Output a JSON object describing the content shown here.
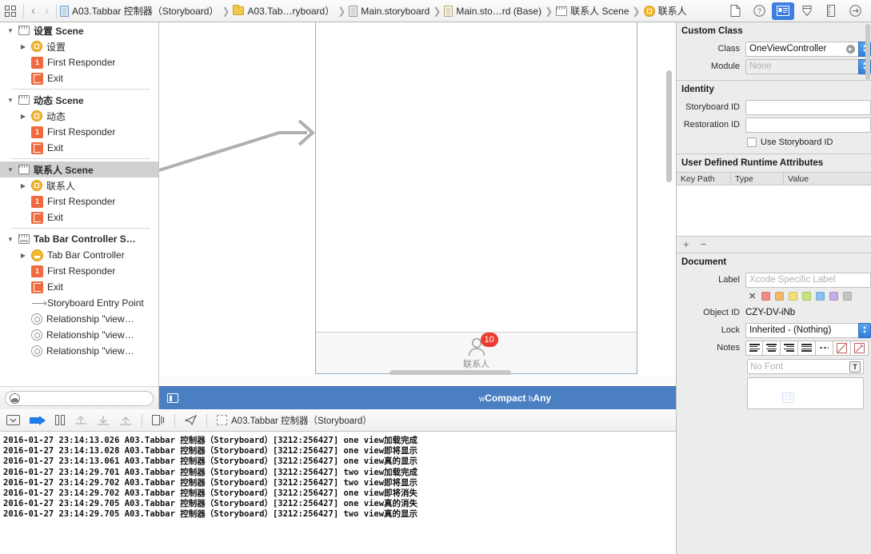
{
  "jumpbar": {
    "grid_icon": "grid-view-icon",
    "back_label": "‹",
    "forward_label": "›",
    "crumbs": [
      {
        "icon": "blue-file-icon",
        "label": "A03.Tabbar 控制器（Storyboard）"
      },
      {
        "icon": "folder-icon",
        "label": "A03.Tab…ryboard）"
      },
      {
        "icon": "storyboard-file-icon",
        "label": "Main.storyboard"
      },
      {
        "icon": "storyboard-base-file-icon",
        "label": "Main.sto…rd (Base)"
      },
      {
        "icon": "scene-icon",
        "label": "联系人 Scene"
      },
      {
        "icon": "view-controller-icon",
        "label": "联系人"
      }
    ],
    "right_icons": [
      {
        "name": "file-inspector-icon",
        "glyph": "🗎",
        "active": false
      },
      {
        "name": "quick-help-inspector-icon",
        "glyph": "?",
        "active": false
      },
      {
        "name": "identity-inspector-icon",
        "glyph": "▤",
        "active": true
      },
      {
        "name": "attributes-inspector-icon",
        "glyph": "⬍",
        "active": false
      },
      {
        "name": "size-inspector-icon",
        "glyph": "▥",
        "active": false
      },
      {
        "name": "connections-inspector-icon",
        "glyph": "→",
        "active": false
      }
    ]
  },
  "outline": {
    "scenes": [
      {
        "name": "设置 Scene",
        "selected": false,
        "children": [
          {
            "icon": "view-controller-icon",
            "label": "设置",
            "arrow": true
          },
          {
            "icon": "first-responder-icon",
            "label": "First Responder",
            "arrow": false
          },
          {
            "icon": "exit-icon",
            "label": "Exit",
            "arrow": false
          }
        ]
      },
      {
        "name": "动态 Scene",
        "selected": false,
        "children": [
          {
            "icon": "view-controller-icon",
            "label": "动态",
            "arrow": true
          },
          {
            "icon": "first-responder-icon",
            "label": "First Responder",
            "arrow": false
          },
          {
            "icon": "exit-icon",
            "label": "Exit",
            "arrow": false
          }
        ]
      },
      {
        "name": "联系人 Scene",
        "selected": true,
        "children": [
          {
            "icon": "view-controller-icon",
            "label": "联系人",
            "arrow": true
          },
          {
            "icon": "first-responder-icon",
            "label": "First Responder",
            "arrow": false
          },
          {
            "icon": "exit-icon",
            "label": "Exit",
            "arrow": false
          }
        ]
      },
      {
        "name": "Tab Bar Controller S…",
        "selected": false,
        "children": [
          {
            "icon": "tab-bar-controller-icon",
            "label": "Tab Bar Controller",
            "arrow": true
          },
          {
            "icon": "first-responder-icon",
            "label": "First Responder",
            "arrow": false
          },
          {
            "icon": "exit-icon",
            "label": "Exit",
            "arrow": false
          },
          {
            "icon": "storyboard-entry-point-icon",
            "label": "Storyboard Entry Point",
            "arrow": false
          },
          {
            "icon": "relationship-icon",
            "label": "Relationship \"view…",
            "arrow": false
          },
          {
            "icon": "relationship-icon",
            "label": "Relationship \"view…",
            "arrow": false
          },
          {
            "icon": "relationship-icon",
            "label": "Relationship \"view…",
            "arrow": false
          }
        ]
      }
    ],
    "filter_placeholder": ""
  },
  "canvas": {
    "tab_badge": "10",
    "tab_label": "联系人",
    "tab_icon": "person-icon"
  },
  "sizebar": {
    "panel_toggle_icon": "left-panel-toggle-icon",
    "width_prefix": "w",
    "width_class": "Compact",
    "height_prefix": "h",
    "height_class": "Any",
    "right_icons": [
      {
        "name": "resolve-auto-layout-icon",
        "glyph": "⌸"
      },
      {
        "name": "pin-constraints-icon",
        "glyph": "☰"
      },
      {
        "name": "align-constraints-icon",
        "glyph": "⊢⊣"
      },
      {
        "name": "stack-view-icon",
        "glyph": "⊢△⊣"
      }
    ]
  },
  "debugbar": {
    "icons": [
      {
        "name": "hide-debug-area-icon",
        "glyph": "▽",
        "disabled": false
      },
      {
        "name": "continue-execution-icon",
        "glyph": "▶",
        "disabled": false
      },
      {
        "name": "pause-icon",
        "glyph": "‖",
        "disabled": false
      },
      {
        "name": "step-over-icon",
        "glyph": "⤴",
        "disabled": true
      },
      {
        "name": "step-into-icon",
        "glyph": "↓",
        "disabled": true
      },
      {
        "name": "step-out-icon",
        "glyph": "↑",
        "disabled": true
      },
      {
        "name": "view-debugging-icon",
        "glyph": "❐",
        "disabled": false
      },
      {
        "name": "simulate-location-icon",
        "glyph": "➤",
        "disabled": false
      }
    ],
    "process_label": "A03.Tabbar 控制器（Storyboard）"
  },
  "console": {
    "lines": [
      "2016-01-27 23:14:13.026 A03.Tabbar 控制器（Storyboard）[3212:256427] one view加载完成",
      "2016-01-27 23:14:13.028 A03.Tabbar 控制器（Storyboard）[3212:256427] one view即将显示",
      "2016-01-27 23:14:13.061 A03.Tabbar 控制器（Storyboard）[3212:256427] one view真的显示",
      "2016-01-27 23:14:29.701 A03.Tabbar 控制器（Storyboard）[3212:256427] two view加载完成",
      "2016-01-27 23:14:29.702 A03.Tabbar 控制器（Storyboard）[3212:256427] two view即将显示",
      "2016-01-27 23:14:29.702 A03.Tabbar 控制器（Storyboard）[3212:256427] one view即将消失",
      "2016-01-27 23:14:29.705 A03.Tabbar 控制器（Storyboard）[3212:256427] one view真的消失",
      "2016-01-27 23:14:29.705 A03.Tabbar 控制器（Storyboard）[3212:256427] two view真的显示"
    ]
  },
  "inspector": {
    "custom_class": {
      "header": "Custom Class",
      "class_label": "Class",
      "class_value": "OneViewController",
      "module_label": "Module",
      "module_placeholder": "None"
    },
    "identity": {
      "header": "Identity",
      "storyboard_id_label": "Storyboard ID",
      "storyboard_id_value": "",
      "restoration_id_label": "Restoration ID",
      "restoration_id_value": "",
      "use_storyboard_id_label": "Use Storyboard ID",
      "use_storyboard_id_checked": false
    },
    "udra": {
      "header": "User Defined Runtime Attributes",
      "columns": [
        "Key Path",
        "Type",
        "Value"
      ],
      "rows": [],
      "add_label": "+",
      "remove_label": "−"
    },
    "document": {
      "header": "Document",
      "label_label": "Label",
      "label_placeholder": "Xcode Specific Label",
      "swatch_clear": "✕",
      "swatches": [
        "#f08a84",
        "#f3b96b",
        "#f2e077",
        "#c7e37a",
        "#86c2f0",
        "#c3aee8",
        "#c4c4c4"
      ],
      "object_id_label": "Object ID",
      "object_id_value": "CZY-DV-iNb",
      "lock_label": "Lock",
      "lock_value": "Inherited - (Nothing)",
      "notes_label": "Notes",
      "notes_more": "…",
      "font_placeholder": "No Font",
      "font_button": "T",
      "notes_value": ""
    }
  }
}
